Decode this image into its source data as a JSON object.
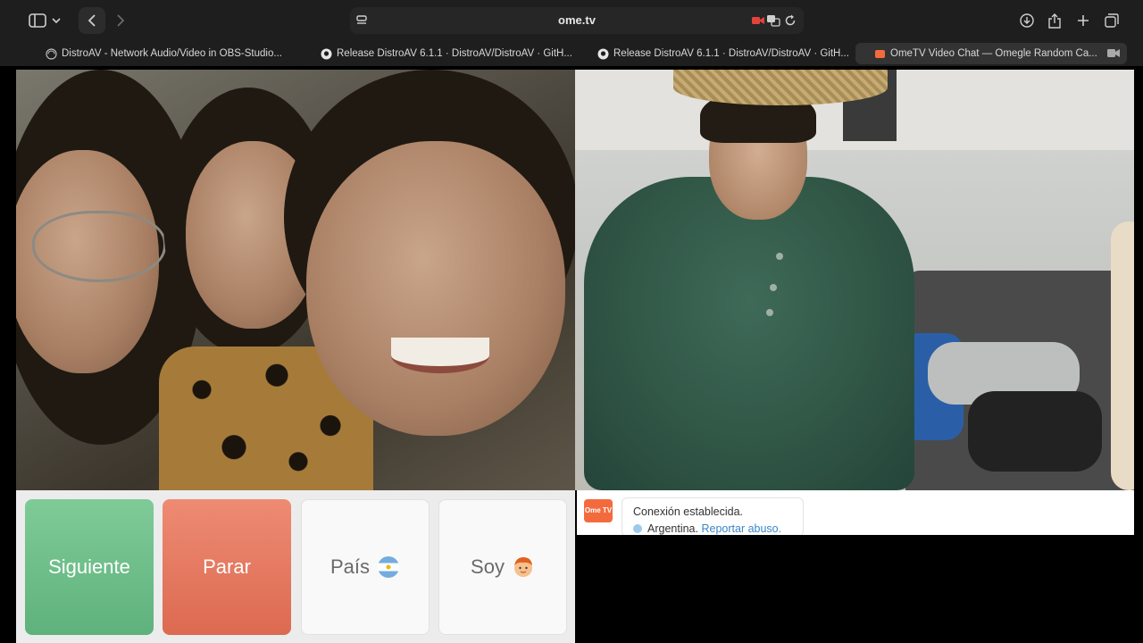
{
  "browser": {
    "address": "ome.tv"
  },
  "tabs": [
    {
      "label": "DistroAV - Network Audio/Video in OBS-Studio..."
    },
    {
      "label": "Release DistroAV 6.1.1 · DistroAV/DistroAV · GitH..."
    },
    {
      "label": "Release DistroAV 6.1.1 · DistroAV/DistroAV · GitH..."
    },
    {
      "label": "OmeTV Video Chat — Omegle Random Ca..."
    }
  ],
  "controls": {
    "next_label": "Siguiente",
    "stop_label": "Parar",
    "country_label": "País",
    "gender_label": "Soy"
  },
  "chat": {
    "logo_text": "Ome TV",
    "status": "Conexión establecida.",
    "country": "Argentina.",
    "report_link": "Reportar abuso."
  },
  "colors": {
    "next": "#5fb27c",
    "stop": "#dc6a51",
    "link": "#3a86c8",
    "ometv_brand": "#f36b3d"
  }
}
